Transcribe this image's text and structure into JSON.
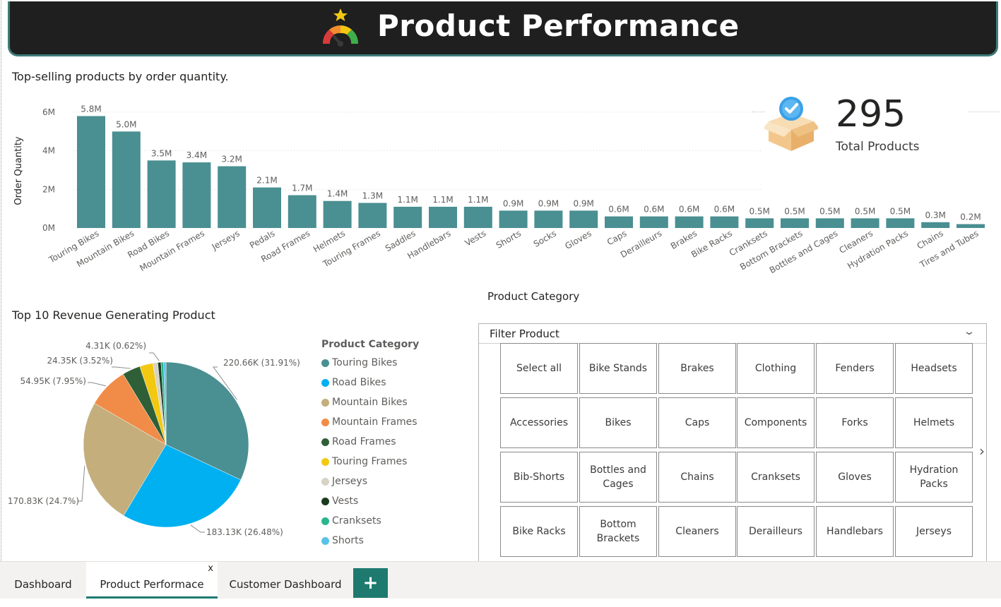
{
  "header": {
    "title": "Product Performance"
  },
  "bar_section": {
    "title": "Top-selling products by order quantity."
  },
  "kpi": {
    "value": "295",
    "label": "Total Products"
  },
  "pie_section": {
    "title": "Top 10 Revenue Generating Product"
  },
  "slicer": {
    "heading": "Product Category",
    "title": "Filter Product",
    "items": [
      "Select all",
      "Bike Stands",
      "Brakes",
      "Clothing",
      "Fenders",
      "Headsets",
      "Accessories",
      "Bikes",
      "Caps",
      "Components",
      "Forks",
      "Helmets",
      "Bib-Shorts",
      "Bottles and Cages",
      "Chains",
      "Cranksets",
      "Gloves",
      "Hydration Packs",
      "Bike Racks",
      "Bottom Brackets",
      "Cleaners",
      "Derailleurs",
      "Handlebars",
      "Jerseys"
    ]
  },
  "tabs": {
    "dashboard": "Dashboard",
    "product": "Product Performace",
    "customer": "Customer Dashboard",
    "close": "x",
    "add": "+"
  },
  "colors": {
    "bar": "#4a8f91",
    "header_bg": "#1f1f1f",
    "accent": "#1e7a6e"
  },
  "chart_data": [
    {
      "type": "bar",
      "title": "Top-selling products by order quantity.",
      "xlabel": "",
      "ylabel": "Order Quantity",
      "ylim": [
        0,
        6000000
      ],
      "yticks": [
        "0M",
        "2M",
        "4M",
        "6M"
      ],
      "ytick_values": [
        0,
        2000000,
        4000000,
        6000000
      ],
      "grid": true,
      "categories": [
        "Touring Bikes",
        "Mountain Bikes",
        "Road Bikes",
        "Mountain Frames",
        "Jerseys",
        "Pedals",
        "Road Frames",
        "Helmets",
        "Touring Frames",
        "Saddles",
        "Handlebars",
        "Vests",
        "Shorts",
        "Socks",
        "Gloves",
        "Caps",
        "Derailleurs",
        "Brakes",
        "Bike Racks",
        "Cranksets",
        "Bottom Brackets",
        "Bottles and Cages",
        "Cleaners",
        "Hydration Packs",
        "Chains",
        "Tires and Tubes"
      ],
      "values": [
        5800000,
        5000000,
        3500000,
        3400000,
        3200000,
        2100000,
        1700000,
        1400000,
        1300000,
        1100000,
        1100000,
        1100000,
        900000,
        900000,
        900000,
        600000,
        600000,
        600000,
        600000,
        500000,
        500000,
        500000,
        500000,
        500000,
        300000,
        200000
      ],
      "labels": [
        "5.8M",
        "5.0M",
        "3.5M",
        "3.4M",
        "3.2M",
        "2.1M",
        "1.7M",
        "1.4M",
        "1.3M",
        "1.1M",
        "1.1M",
        "1.1M",
        "0.9M",
        "0.9M",
        "0.9M",
        "0.6M",
        "0.6M",
        "0.6M",
        "0.6M",
        "0.5M",
        "0.5M",
        "0.5M",
        "0.5M",
        "0.5M",
        "0.3M",
        "0.2M"
      ]
    },
    {
      "type": "pie",
      "title": "Top 10 Revenue Generating Product",
      "legend_title": "Product Category",
      "legend_position": "right",
      "slices": [
        {
          "name": "Touring Bikes",
          "value": 220.66,
          "label": "220.66K (31.91%)",
          "color": "#4a8f91"
        },
        {
          "name": "Road Bikes",
          "value": 183.13,
          "label": "183.13K (26.48%)",
          "color": "#00b0f0"
        },
        {
          "name": "Mountain Bikes",
          "value": 170.83,
          "label": "170.83K (24.7%)",
          "color": "#c4ae7b"
        },
        {
          "name": "Mountain Frames",
          "value": 54.95,
          "label": "54.95K (7.95%)",
          "color": "#f08c48"
        },
        {
          "name": "Road Frames",
          "value": 24.35,
          "label": "24.35K (3.52%)",
          "color": "#2f5f36"
        },
        {
          "name": "Touring Frames",
          "value": 18.0,
          "label": "",
          "color": "#f2c811"
        },
        {
          "name": "Jerseys",
          "value": 6.5,
          "label": "",
          "color": "#d6d3c4"
        },
        {
          "name": "Vests",
          "value": 4.31,
          "label": "4.31K (0.62%)",
          "color": "#1a3b1f"
        },
        {
          "name": "Cranksets",
          "value": 3.5,
          "label": "",
          "color": "#2bb58e"
        },
        {
          "name": "Shorts",
          "value": 3.2,
          "label": "",
          "color": "#5bc2e7"
        }
      ]
    }
  ]
}
